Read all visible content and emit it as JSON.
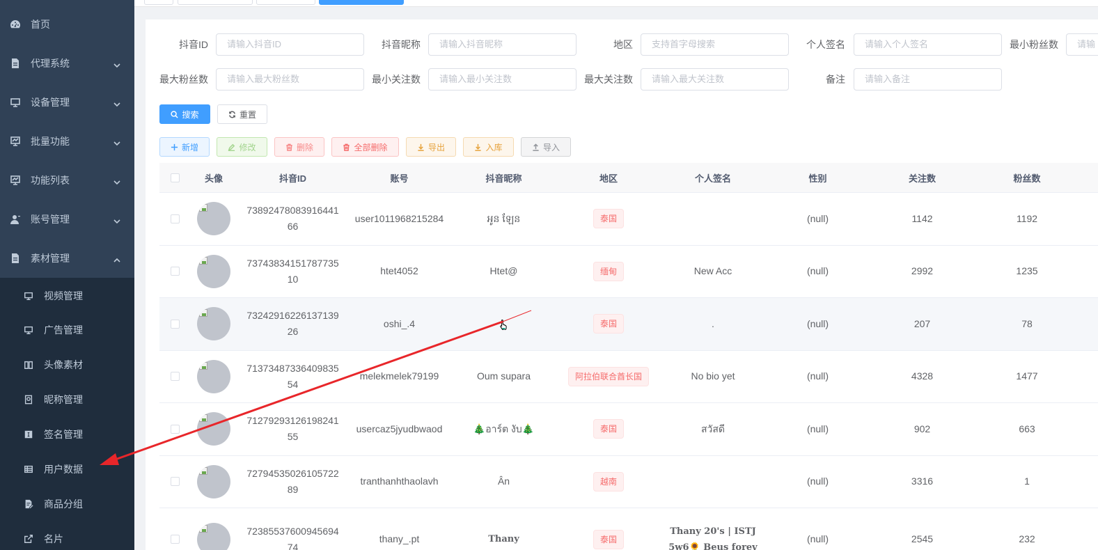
{
  "sidebar": {
    "menu": [
      {
        "label": "首页",
        "icon": "dashboard-icon",
        "arrow": "none"
      },
      {
        "label": "代理系统",
        "icon": "document-icon",
        "arrow": "down"
      },
      {
        "label": "设备管理",
        "icon": "monitor-icon",
        "arrow": "down"
      },
      {
        "label": "批量功能",
        "icon": "chart-monitor-icon",
        "arrow": "down"
      },
      {
        "label": "功能列表",
        "icon": "chart-monitor-icon",
        "arrow": "down"
      },
      {
        "label": "账号管理",
        "icon": "user-icon",
        "arrow": "down"
      },
      {
        "label": "素材管理",
        "icon": "document-icon",
        "arrow": "up"
      }
    ],
    "submenu": [
      {
        "label": "视频管理",
        "icon": "monitor-icon"
      },
      {
        "label": "广告管理",
        "icon": "monitor-icon"
      },
      {
        "label": "头像素材",
        "icon": "book-icon"
      },
      {
        "label": "昵称管理",
        "icon": "nickname-icon"
      },
      {
        "label": "签名管理",
        "icon": "signature-icon"
      },
      {
        "label": "用户数据",
        "icon": "table-icon"
      },
      {
        "label": "商品分组",
        "icon": "edit-doc-icon"
      },
      {
        "label": "名片",
        "icon": "external-link-icon"
      }
    ]
  },
  "filters": {
    "douyin_id": {
      "label": "抖音ID",
      "placeholder": "请输入抖音ID"
    },
    "nickname": {
      "label": "抖音昵称",
      "placeholder": "请输入抖音昵称"
    },
    "region": {
      "label": "地区",
      "placeholder": "支持首字母搜索"
    },
    "signature": {
      "label": "个人签名",
      "placeholder": "请输入个人签名"
    },
    "min_fans": {
      "label": "最小粉丝数",
      "placeholder": "请输"
    },
    "max_fans": {
      "label": "最大粉丝数",
      "placeholder": "请输入最大粉丝数"
    },
    "min_follow": {
      "label": "最小关注数",
      "placeholder": "请输入最小关注数"
    },
    "max_follow": {
      "label": "最大关注数",
      "placeholder": "请输入最大关注数"
    },
    "remark": {
      "label": "备注",
      "placeholder": "请输入备注"
    }
  },
  "buttons": {
    "search": "搜索",
    "reset": "重置",
    "add": "新增",
    "edit": "修改",
    "delete": "删除",
    "delete_all": "全部删除",
    "export": "导出",
    "stock_in": "入库",
    "import": "导入"
  },
  "table": {
    "columns": [
      "头像",
      "抖音ID",
      "账号",
      "抖音昵称",
      "地区",
      "个人签名",
      "性别",
      "关注数",
      "粉丝数"
    ],
    "rows": [
      {
        "id_line1": "73892478083916441",
        "id_line2": "66",
        "account": "user1011968215284",
        "nickname": "អូន ឡែន",
        "region": "泰国",
        "signature": "",
        "gender": "(null)",
        "following": "1142",
        "fans": "1192"
      },
      {
        "id_line1": "73743834151787735",
        "id_line2": "10",
        "account": "htet4052",
        "nickname": "Htet@",
        "region": "缅甸",
        "signature": "New Acc",
        "gender": "(null)",
        "following": "2992",
        "fans": "1235"
      },
      {
        "id_line1": "73242916226137139",
        "id_line2": "26",
        "account": "oshi_.4",
        "nickname": "",
        "region": "泰国",
        "signature": ".",
        "gender": "(null)",
        "following": "207",
        "fans": "78"
      },
      {
        "id_line1": "71373487336409835",
        "id_line2": "54",
        "account": "melekmelek79199",
        "nickname": "Oum supara",
        "region": "阿拉伯联合酋长国",
        "signature": "No bio yet",
        "gender": "(null)",
        "following": "4328",
        "fans": "1477"
      },
      {
        "id_line1": "71279293126198241",
        "id_line2": "55",
        "account": "usercaz5jyudbwaod",
        "nickname": "🎄อาร์ต งับ🎄",
        "region": "泰国",
        "signature": "สวัสดี",
        "gender": "(null)",
        "following": "902",
        "fans": "663"
      },
      {
        "id_line1": "72794535026105722",
        "id_line2": "89",
        "account": "tranthanhthaolavh",
        "nickname": "Ân",
        "region": "越南",
        "signature": "",
        "gender": "(null)",
        "following": "3316",
        "fans": "1"
      },
      {
        "id_line1": "72385537600945694",
        "id_line2": "74",
        "account": "thany_.pt",
        "nickname": "Thany",
        "region": "泰国",
        "signature_line1": "Thany 20's | ISTJ",
        "signature_line2": "5w6🌻 Beus forev",
        "gender": "(null)",
        "following": "2545",
        "fans": "232"
      }
    ]
  },
  "colors": {
    "sidebar_bg": "#304156",
    "submenu_bg": "#1f2d3d",
    "primary": "#409eff",
    "danger": "#f56c6c",
    "annotation_arrow": "#e8262a"
  }
}
